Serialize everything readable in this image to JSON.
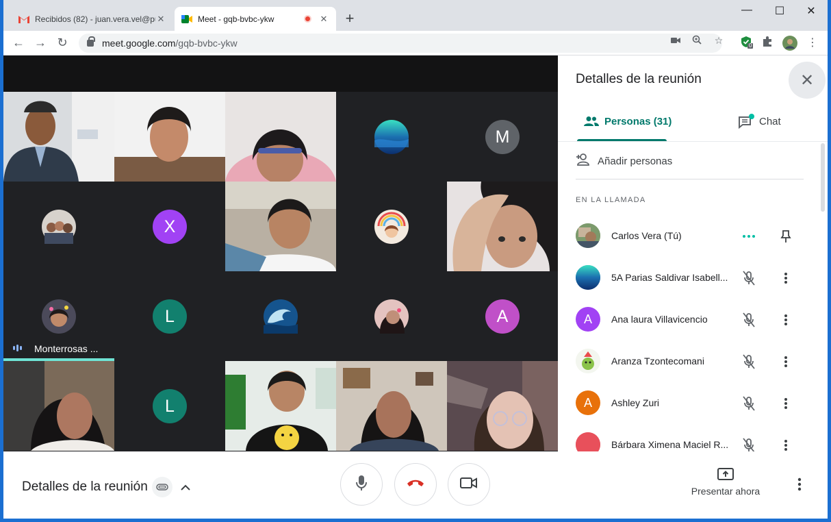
{
  "browser": {
    "tabs": [
      {
        "title": "Recibidos (82) - juan.vera.vel@pu",
        "icon": "gmail-icon",
        "active": false
      },
      {
        "title": "Meet - gqb-bvbc-ykw",
        "icon": "meet-icon",
        "active": true,
        "recording": true
      }
    ],
    "new_tab": "+",
    "url_host": "meet.google.com",
    "url_path": "/gqb-bvbc-ykw",
    "extension_badge": "0"
  },
  "tiles": [
    {
      "kind": "photo",
      "desc": "man-with-tie"
    },
    {
      "kind": "photo",
      "desc": "girl"
    },
    {
      "kind": "photo",
      "desc": "girl-pink-hoodie"
    },
    {
      "kind": "avatar-image",
      "desc": "ocean"
    },
    {
      "kind": "letter",
      "letter": "M",
      "color": "#5f6368"
    },
    {
      "kind": "avatar-image",
      "desc": "group-selfie"
    },
    {
      "kind": "letter",
      "letter": "X",
      "color": "#a142f4"
    },
    {
      "kind": "photo",
      "desc": "boy-headphones"
    },
    {
      "kind": "avatar-image",
      "desc": "rainbow-character"
    },
    {
      "kind": "photo",
      "desc": "girl-hand-on-head"
    },
    {
      "kind": "avatar-image",
      "desc": "girl-flowers",
      "name": "Monterrosas ...",
      "speaking": true
    },
    {
      "kind": "letter",
      "letter": "L",
      "color": "#12806e"
    },
    {
      "kind": "avatar-image",
      "desc": "wave"
    },
    {
      "kind": "avatar-image",
      "desc": "girl-selfie"
    },
    {
      "kind": "letter",
      "letter": "A",
      "color": "#c050c8"
    },
    {
      "kind": "photo",
      "desc": "girl-dark-hair"
    },
    {
      "kind": "letter",
      "letter": "L",
      "color": "#12806e"
    },
    {
      "kind": "photo",
      "desc": "boy-smiley-shirt"
    },
    {
      "kind": "photo",
      "desc": "girl-room"
    },
    {
      "kind": "photo",
      "desc": "girl-glasses"
    }
  ],
  "panel": {
    "title": "Detalles de la reunión",
    "tab_people": "Personas (31)",
    "tab_chat": "Chat",
    "add_people": "Añadir personas",
    "section": "EN LA LLAMADA",
    "people": [
      {
        "name": "Carlos Vera (Tú)",
        "avatar_color": "#6b8f5a",
        "letter": "",
        "self": true
      },
      {
        "name": "5A Parias Saldivar Isabell...",
        "avatar_color": "#1f7fa8",
        "letter": ""
      },
      {
        "name": "Ana laura Villavicencio",
        "avatar_color": "#a142f4",
        "letter": "A"
      },
      {
        "name": "Aranza Tzontecomani",
        "avatar_color": "#eef5e8",
        "letter": ""
      },
      {
        "name": "Ashley Zuri",
        "avatar_color": "#e8710a",
        "letter": "A"
      },
      {
        "name": "Bárbara Ximena Maciel R...",
        "avatar_color": "#e8505b",
        "letter": ""
      }
    ]
  },
  "bottom": {
    "meeting_details": "Detalles de la reunión",
    "present": "Presentar ahora"
  }
}
